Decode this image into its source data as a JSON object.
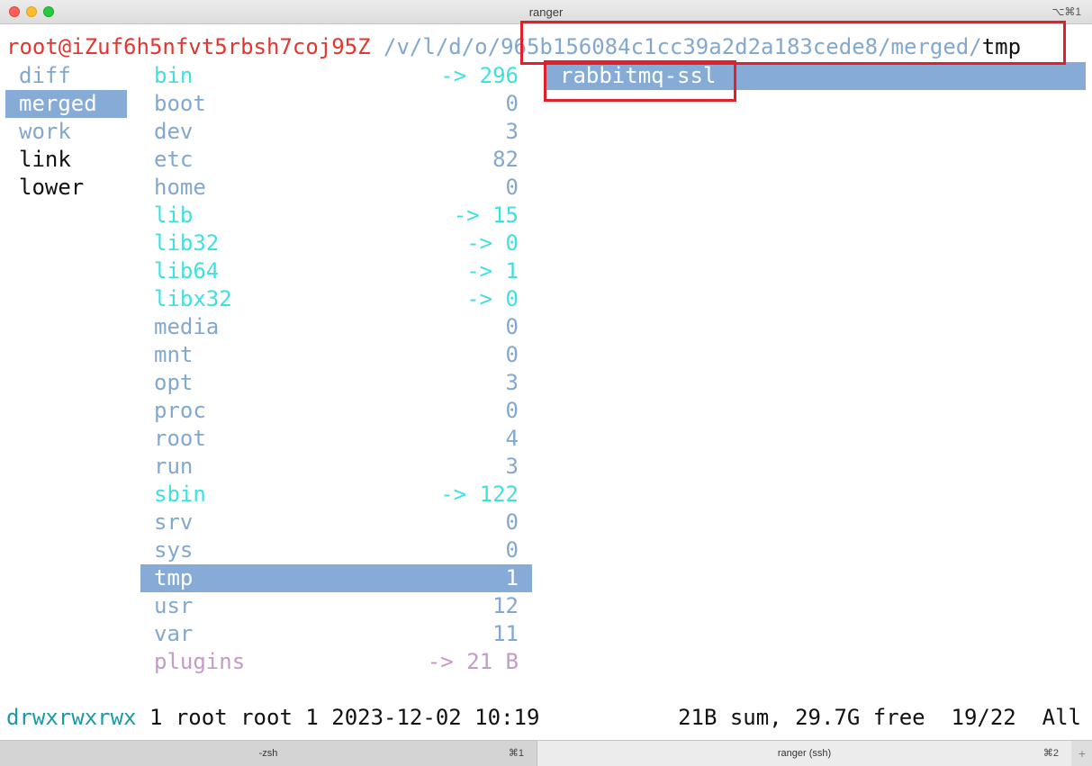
{
  "window": {
    "title": "ranger",
    "shortcut": "⌥⌘1"
  },
  "path": {
    "user_host": "root@iZuf6h5nfvt5rbsh7coj95Z",
    "dir": " /v/l/d/o/965b156084c1cc39a2d2a183cede8/merged/",
    "current": "tmp"
  },
  "parent_column": {
    "items": [
      {
        "label": "diff",
        "kind": "dir",
        "selected": false
      },
      {
        "label": "merged",
        "kind": "dir",
        "selected": true
      },
      {
        "label": "work",
        "kind": "dir",
        "selected": false
      },
      {
        "label": "link",
        "kind": "plain",
        "selected": false
      },
      {
        "label": "lower",
        "kind": "plain",
        "selected": false
      }
    ]
  },
  "current_column": {
    "items": [
      {
        "name": "bin",
        "size": "-> 296",
        "kind": "link",
        "selected": false
      },
      {
        "name": "boot",
        "size": "0",
        "kind": "dir",
        "selected": false
      },
      {
        "name": "dev",
        "size": "3",
        "kind": "dir",
        "selected": false
      },
      {
        "name": "etc",
        "size": "82",
        "kind": "dir",
        "selected": false
      },
      {
        "name": "home",
        "size": "0",
        "kind": "dir",
        "selected": false
      },
      {
        "name": "lib",
        "size": "-> 15",
        "kind": "link",
        "selected": false
      },
      {
        "name": "lib32",
        "size": "-> 0",
        "kind": "link",
        "selected": false
      },
      {
        "name": "lib64",
        "size": "-> 1",
        "kind": "link",
        "selected": false
      },
      {
        "name": "libx32",
        "size": "-> 0",
        "kind": "link",
        "selected": false
      },
      {
        "name": "media",
        "size": "0",
        "kind": "dir",
        "selected": false
      },
      {
        "name": "mnt",
        "size": "0",
        "kind": "dir",
        "selected": false
      },
      {
        "name": "opt",
        "size": "3",
        "kind": "dir",
        "selected": false
      },
      {
        "name": "proc",
        "size": "0",
        "kind": "dir",
        "selected": false
      },
      {
        "name": "root",
        "size": "4",
        "kind": "dir",
        "selected": false
      },
      {
        "name": "run",
        "size": "3",
        "kind": "dir",
        "selected": false
      },
      {
        "name": "sbin",
        "size": "-> 122",
        "kind": "link",
        "selected": false
      },
      {
        "name": "srv",
        "size": "0",
        "kind": "dir",
        "selected": false
      },
      {
        "name": "sys",
        "size": "0",
        "kind": "dir",
        "selected": false
      },
      {
        "name": "tmp",
        "size": "1",
        "kind": "dir",
        "selected": true
      },
      {
        "name": "usr",
        "size": "12",
        "kind": "dir",
        "selected": false
      },
      {
        "name": "var",
        "size": "11",
        "kind": "dir",
        "selected": false
      },
      {
        "name": "plugins",
        "size": "-> 21 B",
        "kind": "plugin",
        "selected": false
      }
    ]
  },
  "preview_column": {
    "items": [
      "rabbitmq-ssl"
    ]
  },
  "status": {
    "perms": "drwxrwxrwx",
    "info": " 1 root root 1 2023-12-02 10:19",
    "right": "21B sum, 29.7G free  19/22  All"
  },
  "tabs": [
    {
      "label": "-zsh",
      "shortcut": "⌘1"
    },
    {
      "label": "ranger (ssh)",
      "shortcut": "⌘2"
    }
  ],
  "tab_add_label": "+",
  "colors": {
    "selection": "#85abd6",
    "directory": "#82a8d0",
    "symlink": "#3ee0e0",
    "user_host": "#e3342f",
    "highlight_box": "#e0202a"
  }
}
